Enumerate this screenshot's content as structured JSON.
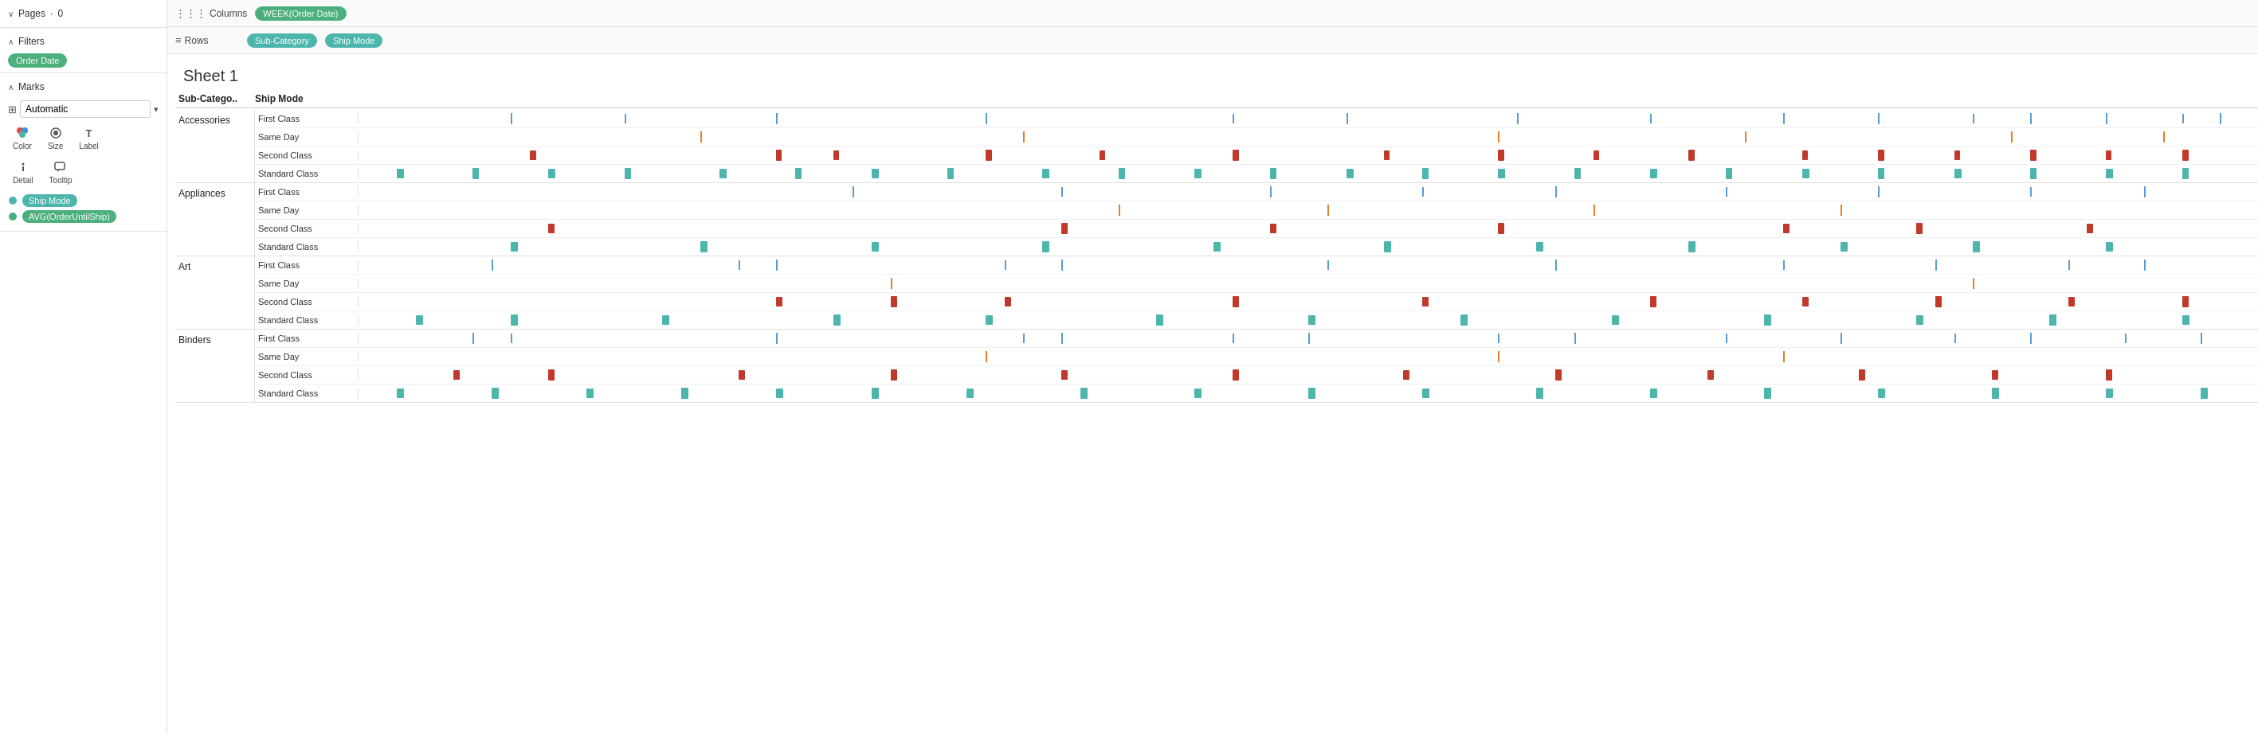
{
  "leftPanel": {
    "pages": {
      "label": "Pages",
      "count": "0",
      "chevron": "∨"
    },
    "filters": {
      "label": "Filters",
      "chevron": "∧",
      "items": [
        {
          "label": "Order Date",
          "color": "green"
        }
      ]
    },
    "marks": {
      "label": "Marks",
      "chevron": "∧",
      "type": "Automatic",
      "icons": [
        {
          "name": "color",
          "label": "Color",
          "icon": "⬡"
        },
        {
          "name": "size",
          "label": "Size",
          "icon": "◉"
        },
        {
          "name": "label",
          "label": "Label",
          "icon": "T"
        },
        {
          "name": "detail",
          "label": "Detail",
          "icon": "+"
        },
        {
          "name": "tooltip",
          "label": "Tooltip",
          "icon": "💬"
        }
      ],
      "legends": [
        {
          "label": "Ship Mode",
          "color": "teal"
        },
        {
          "label": "AVG(OrderUntilShip)",
          "color": "green"
        }
      ]
    }
  },
  "shelves": {
    "columns": {
      "icon": "⋮⋮⋮",
      "label": "Columns",
      "pills": [
        {
          "label": "WEEK(Order Date)",
          "color": "green"
        }
      ]
    },
    "rows": {
      "icon": "≡",
      "label": "Rows",
      "pills": [
        {
          "label": "Sub-Category",
          "color": "teal"
        },
        {
          "label": "Ship Mode",
          "color": "teal"
        }
      ]
    }
  },
  "sheet": {
    "title": "Sheet 1",
    "headers": {
      "subCategory": "Sub-Catego..",
      "shipMode": "Ship Mode"
    }
  },
  "categories": [
    {
      "name": "Accessories",
      "shipModes": [
        {
          "label": "First Class",
          "markType": "blue-lines"
        },
        {
          "label": "Same Day",
          "markType": "orange-lines"
        },
        {
          "label": "Second Class",
          "markType": "red-rect"
        },
        {
          "label": "Standard Class",
          "markType": "teal-rect"
        }
      ]
    },
    {
      "name": "Appliances",
      "shipModes": [
        {
          "label": "First Class",
          "markType": "blue-lines"
        },
        {
          "label": "Same Day",
          "markType": "orange-lines"
        },
        {
          "label": "Second Class",
          "markType": "red-rect"
        },
        {
          "label": "Standard Class",
          "markType": "teal-rect"
        }
      ]
    },
    {
      "name": "Art",
      "shipModes": [
        {
          "label": "First Class",
          "markType": "blue-lines"
        },
        {
          "label": "Same Day",
          "markType": "orange-lines"
        },
        {
          "label": "Second Class",
          "markType": "red-rect"
        },
        {
          "label": "Standard Class",
          "markType": "teal-rect"
        }
      ]
    },
    {
      "name": "Binders",
      "shipModes": [
        {
          "label": "First Class",
          "markType": "blue-lines"
        },
        {
          "label": "Same Day",
          "markType": "orange-lines"
        },
        {
          "label": "Second Class",
          "markType": "red-rect"
        },
        {
          "label": "Standard Class",
          "markType": "teal-rect"
        }
      ]
    }
  ]
}
